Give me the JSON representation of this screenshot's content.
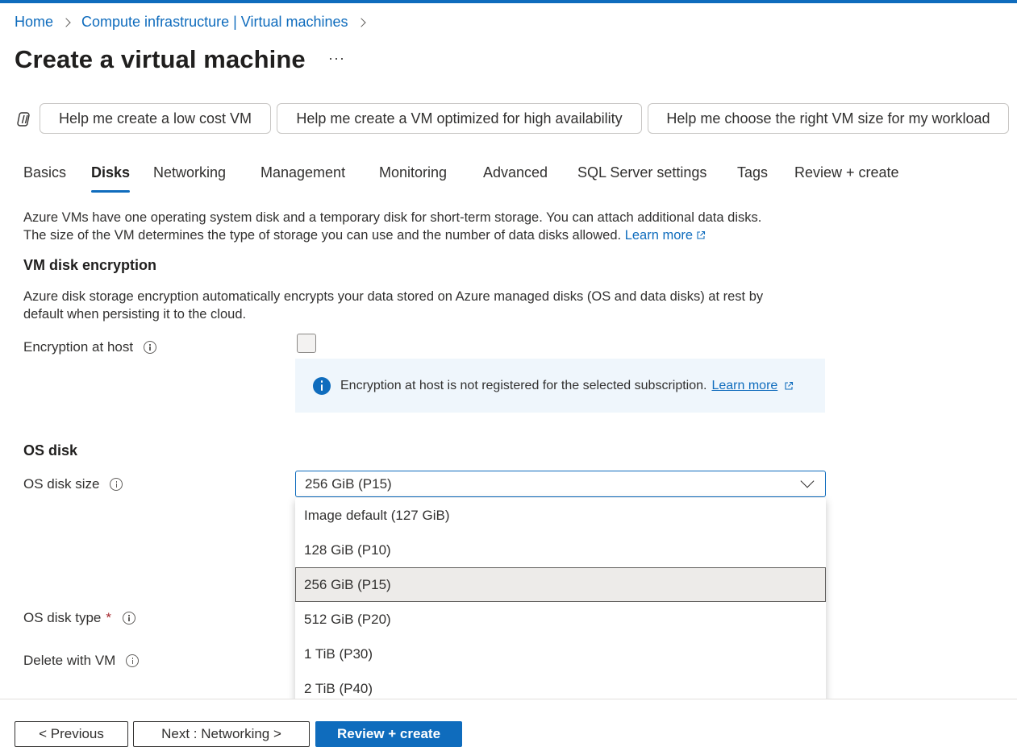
{
  "breadcrumb": {
    "home": "Home",
    "parent": "Compute infrastructure | Virtual machines"
  },
  "page": {
    "title": "Create a virtual machine",
    "more": "···"
  },
  "prompts": [
    "Help me create a low cost VM",
    "Help me create a VM optimized for high availability",
    "Help me choose the right VM size for my workload"
  ],
  "tabs": [
    "Basics",
    "Disks",
    "Networking",
    "Management",
    "Monitoring",
    "Advanced",
    "SQL Server settings",
    "Tags",
    "Review + create"
  ],
  "active_tab": "Disks",
  "intro": {
    "line1": "Azure VMs have one operating system disk and a temporary disk for short-term storage. You can attach additional data disks.",
    "line2": "The size of the VM determines the type of storage you can use and the number of data disks allowed.",
    "link": "Learn more"
  },
  "encryption": {
    "title": "VM disk encryption",
    "desc1": "Azure disk storage encryption automatically encrypts your data stored on Azure managed disks (OS and data disks) at rest by",
    "desc2": "default when persisting it to the cloud.",
    "host_label": "Encryption at host",
    "host_checked": false,
    "banner_text": "Encryption at host is not registered for the selected subscription.",
    "banner_link": "Learn more"
  },
  "os_disk": {
    "title": "OS disk",
    "size_label": "OS disk size",
    "size_value": "256 GiB (P15)",
    "size_options": [
      "Image default (127 GiB)",
      "128 GiB (P10)",
      "256 GiB (P15)",
      "512 GiB (P20)",
      "1 TiB (P30)",
      "2 TiB (P40)"
    ],
    "type_label": "OS disk type",
    "required_mark": "*",
    "delete_label": "Delete with VM"
  },
  "footer": {
    "previous": "< Previous",
    "next": "Next : Networking >",
    "review": "Review + create"
  },
  "colors": {
    "accent": "#0f6cbd",
    "banner_bg": "#eff6fc",
    "selected_option_bg": "#edebe9",
    "required": "#a4262c"
  }
}
